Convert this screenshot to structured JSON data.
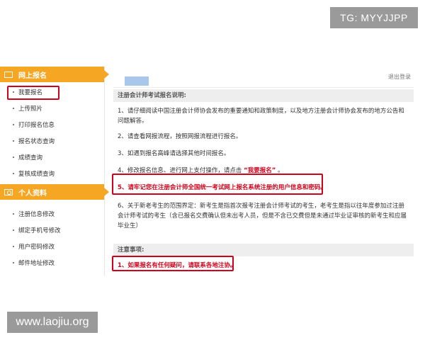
{
  "watermarks": {
    "top": "TG: MYYJJPP",
    "bottom": "www.laojiu.org"
  },
  "sidebar": {
    "section1": {
      "title": "网上报名",
      "icon": "monitor-icon"
    },
    "items1": [
      "我要报名",
      "上传照片",
      "打印报名信息",
      "报名状态查询",
      "成绩查询",
      "复核成绩查询"
    ],
    "section2": {
      "title": "个人资料",
      "icon": "person-card-icon"
    },
    "items2": [
      "注册信息修改",
      "绑定手机号修改",
      "用户密码修改",
      "邮件地址修改"
    ]
  },
  "header": {
    "logout": "退出登录"
  },
  "instructions": {
    "title": "注册会计师考试报名说明:",
    "item1": "1、请仔细阅读中国注册会计师协会发布的重要通知和政策制度，以及地方注册会计师协会发布的地方公告和问题解答。",
    "item2": "2、请查看网报流程，按照网报流程进行报名。",
    "item3": "3、如遇到报名高峰请选择其他时间报名。",
    "item4_prefix": "4、修改报名信息、进行网上支付操作，请点击 ",
    "item4_link": "“我要报名”",
    "item4_suffix": " 。",
    "item5": "5、请牢记您在注册会计师全国统一考试网上报名系统注册的用户信息和密码。",
    "item6": "6、关于新老考生的范围界定：新考生是指首次报考注册会计师考试的考生，老考生是指以往年度参加过注册会计师考试的考生（含已报名交费确认但未出考人员，但是不含已交费但是未通过毕业证审核的新考生和应届毕业生）"
  },
  "notes": {
    "title": "注意事项:",
    "item1": "1、如果报名有任何疑问，请联系各地注协。"
  },
  "colors": {
    "accent": "#f5a623",
    "highlight": "#d0021b",
    "logo": "#a9c7ea"
  }
}
